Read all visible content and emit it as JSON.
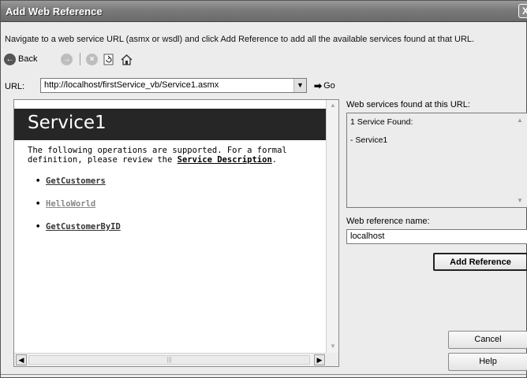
{
  "window": {
    "title": "Add Web Reference",
    "close_glyph": "X"
  },
  "instructions": "Navigate to a web service URL (asmx or wsdl) and click Add Reference to add all the available services found at that URL.",
  "toolbar": {
    "back_label": "Back",
    "back_icon": "back-arrow-icon",
    "forward_icon": "forward-arrow-icon",
    "stop_icon": "stop-icon",
    "refresh_icon": "refresh-icon",
    "home_icon": "home-icon"
  },
  "url_bar": {
    "label": "URL:",
    "value": "http://localhost/firstService_vb/Service1.asmx",
    "go_label": "Go"
  },
  "service_page": {
    "title": "Service1",
    "intro": "The following operations are supported. For a formal definition, please review the",
    "description_link": "Service Description",
    "operations": [
      "GetCustomers",
      "HelloWorld",
      "GetCustomerByID"
    ]
  },
  "found_panel": {
    "label": "Web services found at this URL:",
    "count_text": "1 Service Found:",
    "services": [
      "- Service1"
    ]
  },
  "reference_name": {
    "label": "Web reference name:",
    "value": "localhost"
  },
  "buttons": {
    "add_reference": "Add Reference",
    "cancel": "Cancel",
    "help": "Help"
  }
}
